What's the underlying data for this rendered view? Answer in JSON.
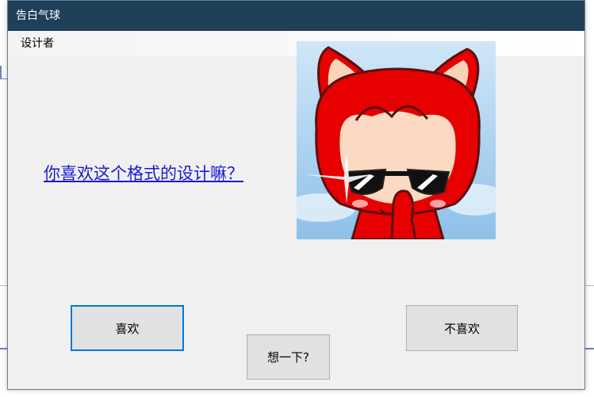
{
  "window": {
    "title": "告白气球"
  },
  "menubar": {
    "items": [
      {
        "label": "设计者"
      }
    ]
  },
  "main": {
    "question_link": "你喜欢这个格式的设计嘛？",
    "picture_icon": "red-fox-with-sunglasses-icon"
  },
  "buttons": {
    "like_label": "喜欢",
    "dislike_label": "不喜欢",
    "think_label": "想一下?"
  },
  "colors": {
    "titlebar": "#1e4059",
    "link": "#1a1ad6",
    "focus_border": "#0078d7",
    "fox_red": "#e60000"
  }
}
